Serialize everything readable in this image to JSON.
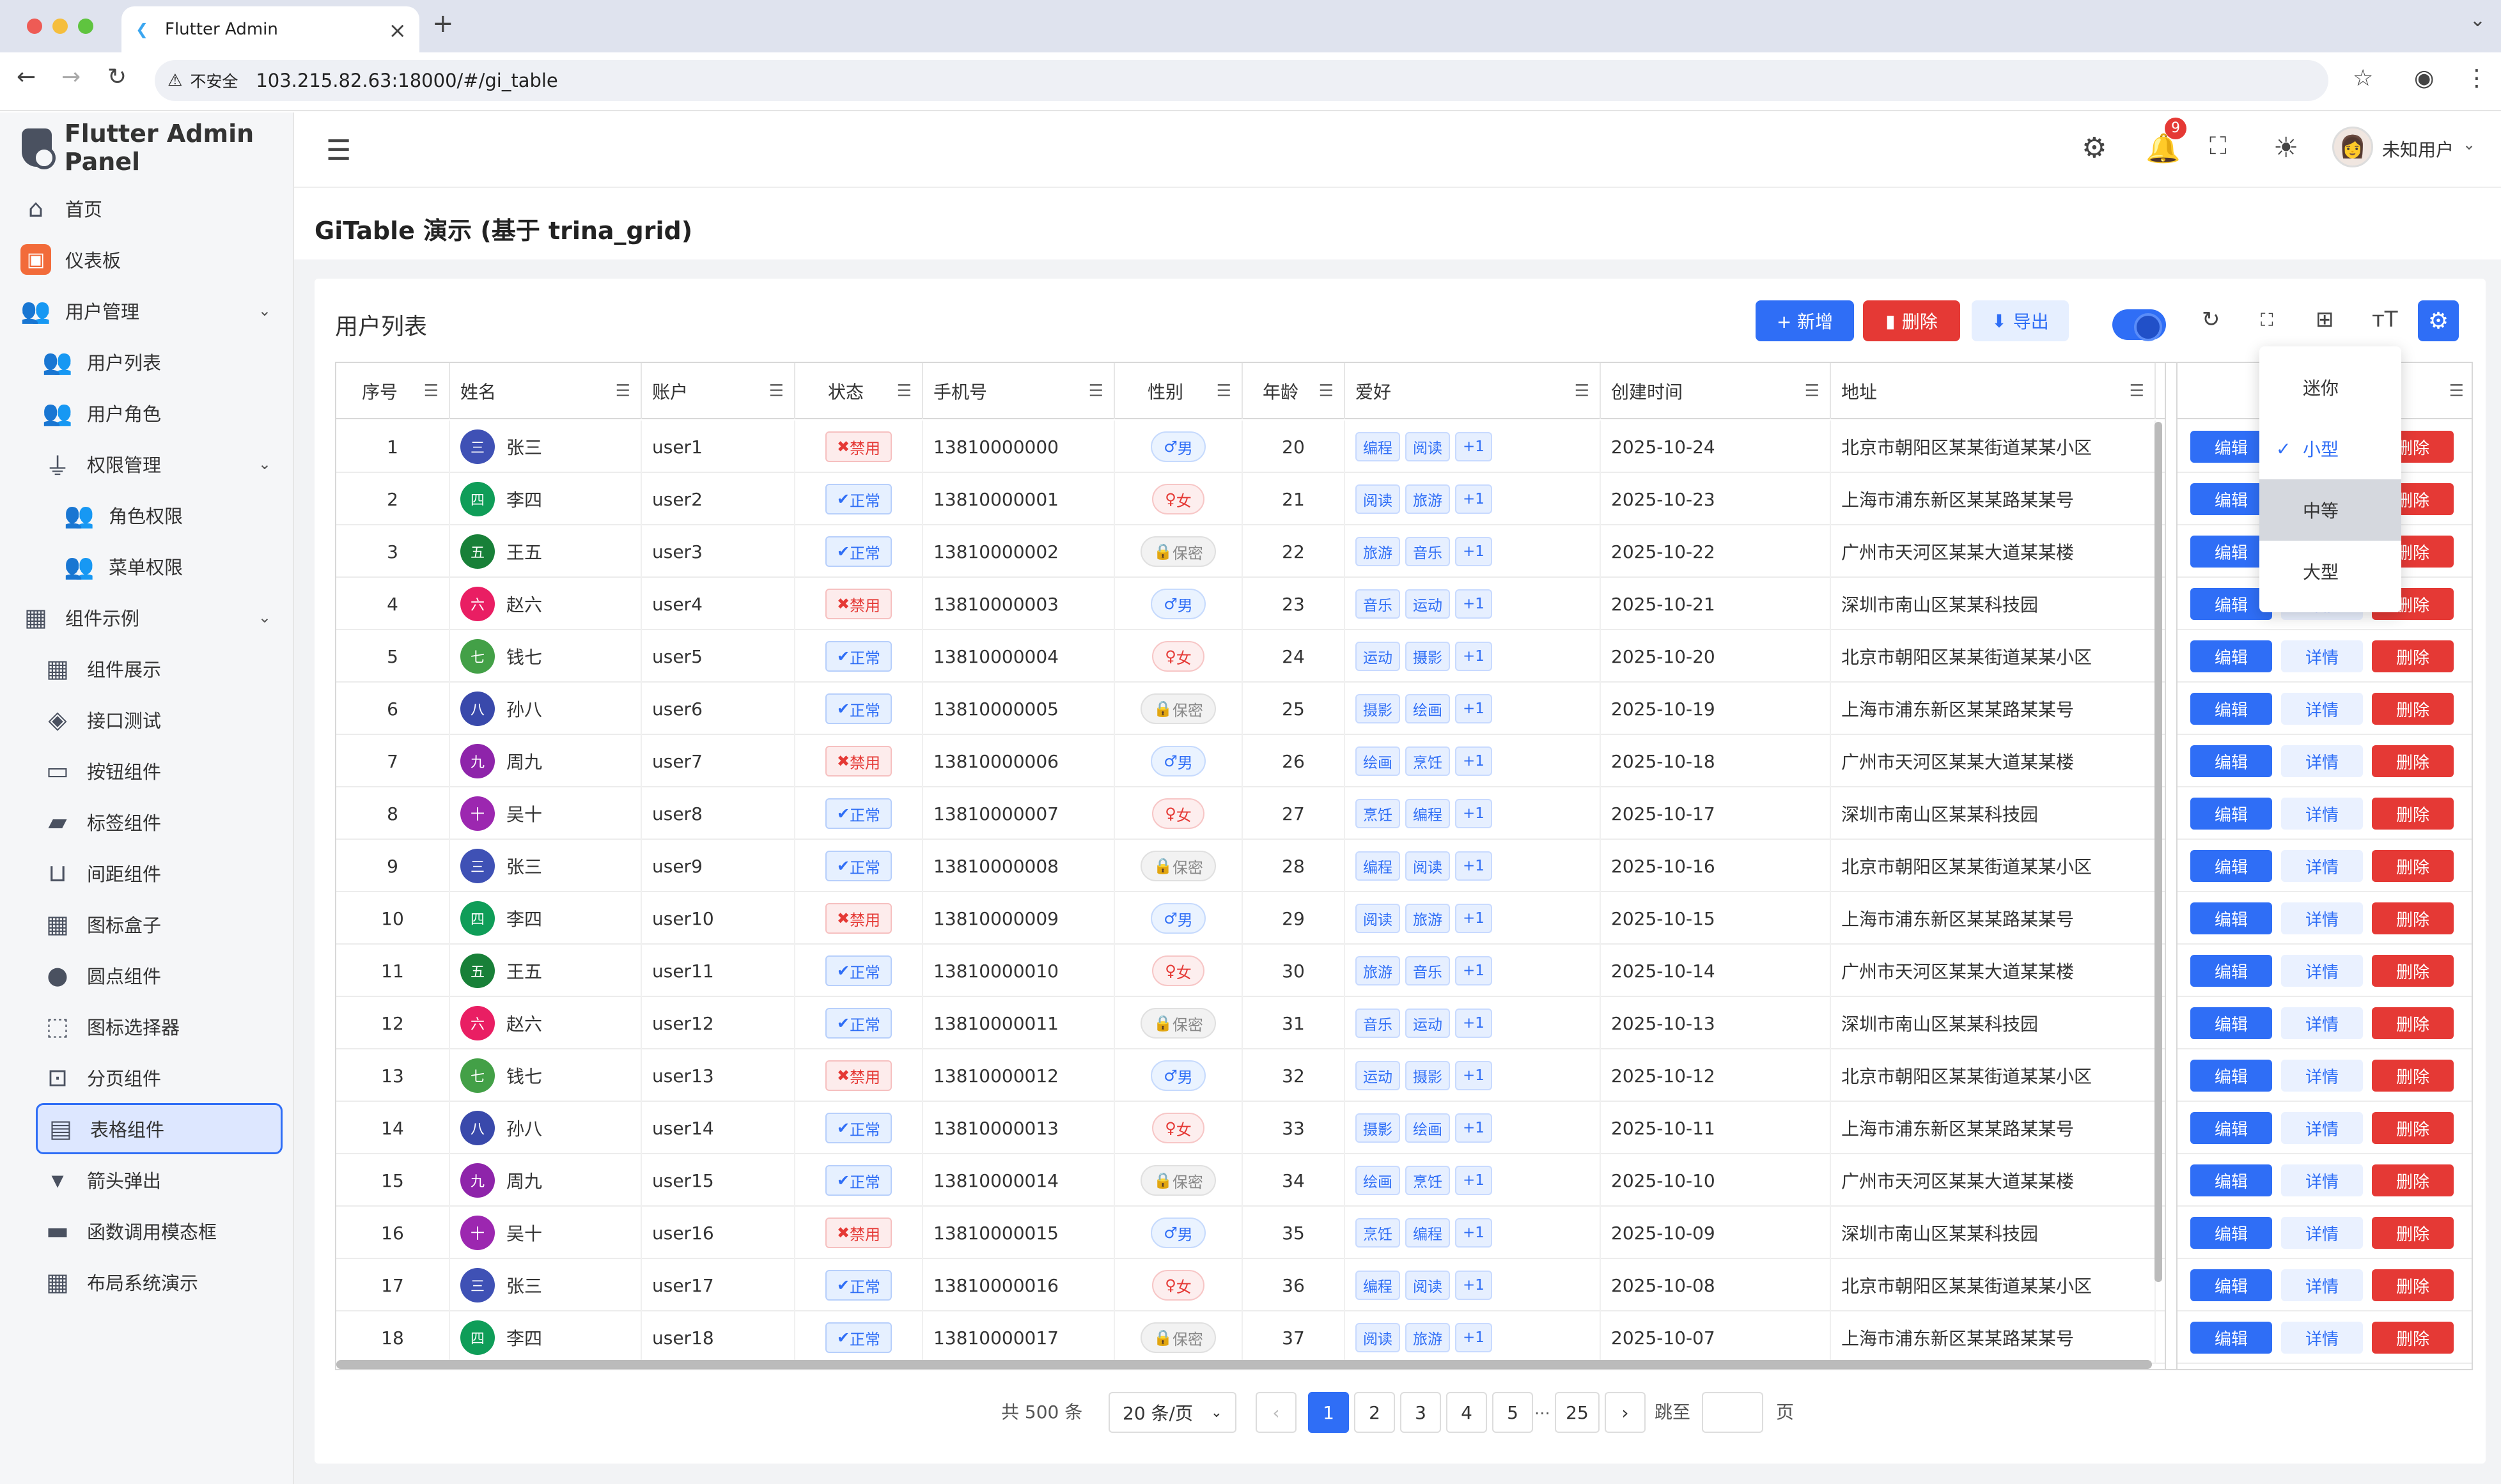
{
  "browser": {
    "tab_title": "Flutter Admin",
    "security_label": "不安全",
    "url": "103.215.82.63:18000/#/gi_table"
  },
  "sidebar": {
    "brand": "Flutter Admin Panel",
    "items": [
      {
        "label": "首页",
        "icon": "home-icon",
        "level": 0
      },
      {
        "label": "仪表板",
        "icon": "dashboard-icon",
        "level": 0
      },
      {
        "label": "用户管理",
        "icon": "users-icon",
        "level": 0,
        "expanded": true
      },
      {
        "label": "用户列表",
        "icon": "users-icon",
        "level": 1
      },
      {
        "label": "用户角色",
        "icon": "users-icon",
        "level": 1
      },
      {
        "label": "权限管理",
        "icon": "plug-icon",
        "level": 1,
        "expanded": true
      },
      {
        "label": "角色权限",
        "icon": "users-icon",
        "level": 2
      },
      {
        "label": "菜单权限",
        "icon": "users-icon",
        "level": 2
      },
      {
        "label": "组件示例",
        "icon": "widgets-icon",
        "level": 0,
        "expanded": true
      },
      {
        "label": "组件展示",
        "icon": "widgets-icon",
        "level": 1
      },
      {
        "label": "接口测试",
        "icon": "api-icon",
        "level": 1
      },
      {
        "label": "按钮组件",
        "icon": "button-icon",
        "level": 1
      },
      {
        "label": "标签组件",
        "icon": "label-icon",
        "level": 1
      },
      {
        "label": "间距组件",
        "icon": "spacing-icon",
        "level": 1
      },
      {
        "label": "图标盒子",
        "icon": "widgets-icon",
        "level": 1
      },
      {
        "label": "圆点组件",
        "icon": "dot-icon",
        "level": 1
      },
      {
        "label": "图标选择器",
        "icon": "picker-icon",
        "level": 1
      },
      {
        "label": "分页组件",
        "icon": "pagination-icon",
        "level": 1
      },
      {
        "label": "表格组件",
        "icon": "table-icon",
        "level": 1,
        "active": true
      },
      {
        "label": "箭头弹出",
        "icon": "arrow-down-icon",
        "level": 1
      },
      {
        "label": "函数调用模态框",
        "icon": "modal-icon",
        "level": 1
      },
      {
        "label": "布局系统演示",
        "icon": "widgets-icon",
        "level": 1
      }
    ]
  },
  "header": {
    "notification_count": "9",
    "user_name": "未知用户"
  },
  "page": {
    "title": "GiTable 演示 (基于 trina_grid)",
    "card_title": "用户列表",
    "buttons": {
      "add": "+ 新增",
      "delete": "删除",
      "export": "导出"
    }
  },
  "table": {
    "columns": [
      "序号",
      "姓名",
      "账户",
      "状态",
      "手机号",
      "性别",
      "年龄",
      "爱好",
      "创建时间",
      "地址"
    ],
    "actions": {
      "edit": "编辑",
      "detail": "详情",
      "delete": "删除"
    },
    "rows": [
      {
        "no": "1",
        "avatar": "三",
        "name": "张三",
        "account": "user1",
        "status": "禁用",
        "phone": "13810000000",
        "gender": "男",
        "age": "20",
        "hobbies": [
          "编程",
          "阅读",
          "+1"
        ],
        "created": "2025-10-24",
        "address": "北京市朝阳区某某街道某某小区"
      },
      {
        "no": "2",
        "avatar": "四",
        "name": "李四",
        "account": "user2",
        "status": "正常",
        "phone": "13810000001",
        "gender": "女",
        "age": "21",
        "hobbies": [
          "阅读",
          "旅游",
          "+1"
        ],
        "created": "2025-10-23",
        "address": "上海市浦东新区某某路某某号"
      },
      {
        "no": "3",
        "avatar": "五",
        "name": "王五",
        "account": "user3",
        "status": "正常",
        "phone": "13810000002",
        "gender": "保密",
        "age": "22",
        "hobbies": [
          "旅游",
          "音乐",
          "+1"
        ],
        "created": "2025-10-22",
        "address": "广州市天河区某某大道某某楼"
      },
      {
        "no": "4",
        "avatar": "六",
        "name": "赵六",
        "account": "user4",
        "status": "禁用",
        "phone": "13810000003",
        "gender": "男",
        "age": "23",
        "hobbies": [
          "音乐",
          "运动",
          "+1"
        ],
        "created": "2025-10-21",
        "address": "深圳市南山区某某科技园"
      },
      {
        "no": "5",
        "avatar": "七",
        "name": "钱七",
        "account": "user5",
        "status": "正常",
        "phone": "13810000004",
        "gender": "女",
        "age": "24",
        "hobbies": [
          "运动",
          "摄影",
          "+1"
        ],
        "created": "2025-10-20",
        "address": "北京市朝阳区某某街道某某小区"
      },
      {
        "no": "6",
        "avatar": "八",
        "name": "孙八",
        "account": "user6",
        "status": "正常",
        "phone": "13810000005",
        "gender": "保密",
        "age": "25",
        "hobbies": [
          "摄影",
          "绘画",
          "+1"
        ],
        "created": "2025-10-19",
        "address": "上海市浦东新区某某路某某号"
      },
      {
        "no": "7",
        "avatar": "九",
        "name": "周九",
        "account": "user7",
        "status": "禁用",
        "phone": "13810000006",
        "gender": "男",
        "age": "26",
        "hobbies": [
          "绘画",
          "烹饪",
          "+1"
        ],
        "created": "2025-10-18",
        "address": "广州市天河区某某大道某某楼"
      },
      {
        "no": "8",
        "avatar": "十",
        "name": "吴十",
        "account": "user8",
        "status": "正常",
        "phone": "13810000007",
        "gender": "女",
        "age": "27",
        "hobbies": [
          "烹饪",
          "编程",
          "+1"
        ],
        "created": "2025-10-17",
        "address": "深圳市南山区某某科技园"
      },
      {
        "no": "9",
        "avatar": "三",
        "name": "张三",
        "account": "user9",
        "status": "正常",
        "phone": "13810000008",
        "gender": "保密",
        "age": "28",
        "hobbies": [
          "编程",
          "阅读",
          "+1"
        ],
        "created": "2025-10-16",
        "address": "北京市朝阳区某某街道某某小区"
      },
      {
        "no": "10",
        "avatar": "四",
        "name": "李四",
        "account": "user10",
        "status": "禁用",
        "phone": "13810000009",
        "gender": "男",
        "age": "29",
        "hobbies": [
          "阅读",
          "旅游",
          "+1"
        ],
        "created": "2025-10-15",
        "address": "上海市浦东新区某某路某某号"
      },
      {
        "no": "11",
        "avatar": "五",
        "name": "王五",
        "account": "user11",
        "status": "正常",
        "phone": "13810000010",
        "gender": "女",
        "age": "30",
        "hobbies": [
          "旅游",
          "音乐",
          "+1"
        ],
        "created": "2025-10-14",
        "address": "广州市天河区某某大道某某楼"
      },
      {
        "no": "12",
        "avatar": "六",
        "name": "赵六",
        "account": "user12",
        "status": "正常",
        "phone": "13810000011",
        "gender": "保密",
        "age": "31",
        "hobbies": [
          "音乐",
          "运动",
          "+1"
        ],
        "created": "2025-10-13",
        "address": "深圳市南山区某某科技园"
      },
      {
        "no": "13",
        "avatar": "七",
        "name": "钱七",
        "account": "user13",
        "status": "禁用",
        "phone": "13810000012",
        "gender": "男",
        "age": "32",
        "hobbies": [
          "运动",
          "摄影",
          "+1"
        ],
        "created": "2025-10-12",
        "address": "北京市朝阳区某某街道某某小区"
      },
      {
        "no": "14",
        "avatar": "八",
        "name": "孙八",
        "account": "user14",
        "status": "正常",
        "phone": "13810000013",
        "gender": "女",
        "age": "33",
        "hobbies": [
          "摄影",
          "绘画",
          "+1"
        ],
        "created": "2025-10-11",
        "address": "上海市浦东新区某某路某某号"
      },
      {
        "no": "15",
        "avatar": "九",
        "name": "周九",
        "account": "user15",
        "status": "正常",
        "phone": "13810000014",
        "gender": "保密",
        "age": "34",
        "hobbies": [
          "绘画",
          "烹饪",
          "+1"
        ],
        "created": "2025-10-10",
        "address": "广州市天河区某某大道某某楼"
      },
      {
        "no": "16",
        "avatar": "十",
        "name": "吴十",
        "account": "user16",
        "status": "禁用",
        "phone": "13810000015",
        "gender": "男",
        "age": "35",
        "hobbies": [
          "烹饪",
          "编程",
          "+1"
        ],
        "created": "2025-10-09",
        "address": "深圳市南山区某某科技园"
      },
      {
        "no": "17",
        "avatar": "三",
        "name": "张三",
        "account": "user17",
        "status": "正常",
        "phone": "13810000016",
        "gender": "女",
        "age": "36",
        "hobbies": [
          "编程",
          "阅读",
          "+1"
        ],
        "created": "2025-10-08",
        "address": "北京市朝阳区某某街道某某小区"
      },
      {
        "no": "18",
        "avatar": "四",
        "name": "李四",
        "account": "user18",
        "status": "正常",
        "phone": "13810000017",
        "gender": "保密",
        "age": "37",
        "hobbies": [
          "阅读",
          "旅游",
          "+1"
        ],
        "created": "2025-10-07",
        "address": "上海市浦东新区某某路某某号"
      }
    ]
  },
  "density_menu": {
    "options": [
      "迷你",
      "小型",
      "中等",
      "大型"
    ],
    "selected": "小型",
    "hovered": "中等"
  },
  "pagination": {
    "total": "共 500 条",
    "page_size": "20 条/页",
    "pages": [
      "1",
      "2",
      "3",
      "4",
      "5",
      "...",
      "25"
    ],
    "current": "1",
    "jump_label": "跳至",
    "page_suffix": "页"
  },
  "colors": {
    "primary": "#2f6ef6",
    "danger": "#e53935",
    "avatar_palette": {
      "三": "#3f51b5",
      "四": "#0f9d58",
      "五": "#188038",
      "六": "#e91e63",
      "七": "#43a047",
      "八": "#3949ab",
      "九": "#8e24aa",
      "十": "#9c27b0"
    }
  }
}
